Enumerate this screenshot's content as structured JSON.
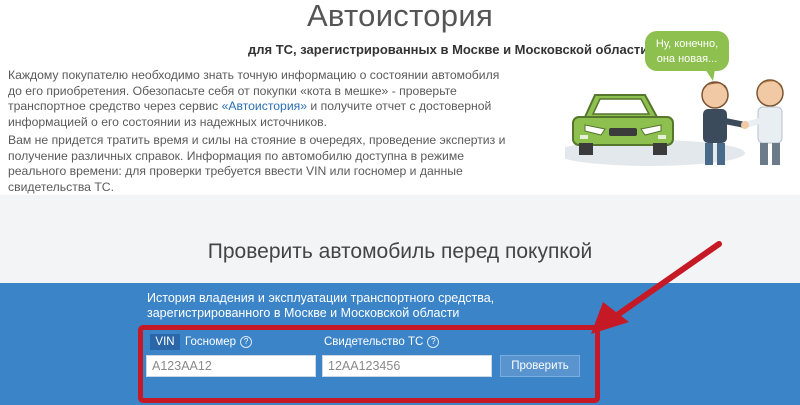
{
  "header": {
    "title": "Автоистория",
    "subtitle": "для ТС, зарегистрированных в Москве и Московской области"
  },
  "intro": {
    "p1_before": "Каждому покупателю необходимо знать точную информацию о состоянии автомобиля до его приобретения. Обезопасьте себя от покупки «кота в мешке» - проверьте транспортное средство через сервис ",
    "p1_link": "«Автоистория»",
    "p1_after": " и получите отчет с достоверной информацией о его состоянии из надежных источников.",
    "p2": "Вам не придется тратить время и силы на стояние в очередях, проведение экспертиз и получение различных справок. Информация по автомобилю доступна в режиме реального времени: для проверки требуется ввести VIN или госномер и данные свидетельства ТС."
  },
  "illustration": {
    "speech_line1": "Ну, конечно,",
    "speech_line2": "она новая..."
  },
  "check_section": {
    "title": "Проверить автомобиль перед покупкой",
    "description": "История владения и эксплуатации транспортного средства, зарегистрированного в Москве и Московской области"
  },
  "form": {
    "tab_vin": "VIN",
    "tab_gosnomer": "Госномер",
    "help_symbol": "?",
    "vin_placeholder": "А123АА12",
    "certificate_label": "Свидетельство ТС",
    "certificate_placeholder": "12АА123456",
    "submit_label": "Проверить"
  },
  "colors": {
    "blue_band": "#3b84c8",
    "highlight_red": "#c51a25",
    "car_green": "#8dc04f"
  }
}
